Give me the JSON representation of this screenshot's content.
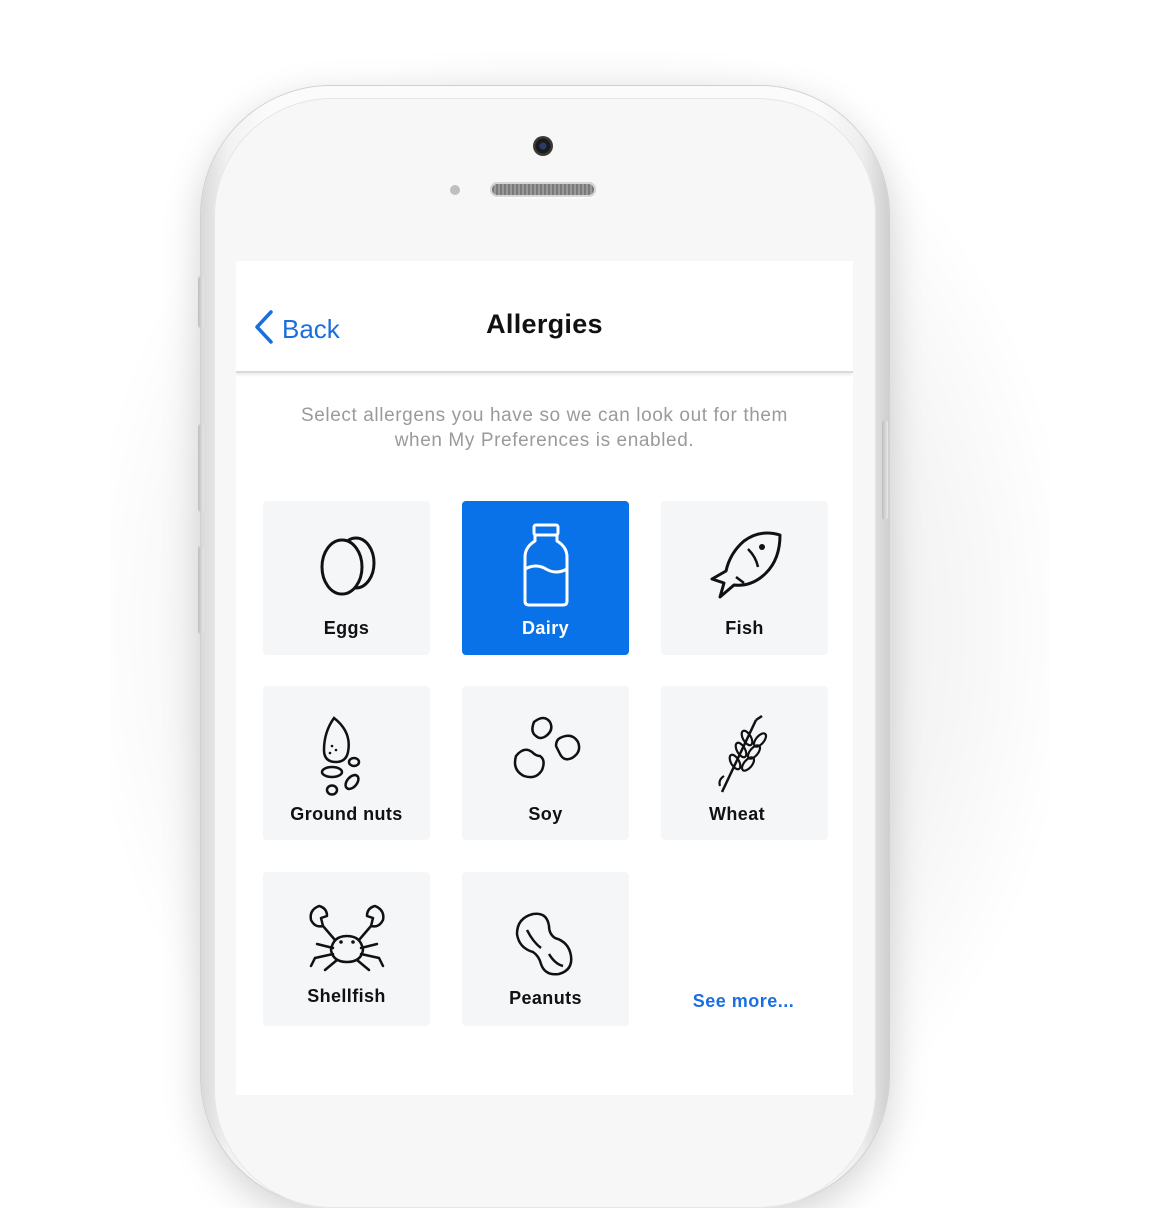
{
  "nav": {
    "back_label": "Back",
    "title": "Allergies"
  },
  "description": "Select allergens you have so we can look out for them when My Preferences is enabled.",
  "allergens": [
    {
      "label": "Eggs",
      "icon": "eggs-icon",
      "selected": false
    },
    {
      "label": "Dairy",
      "icon": "milk-bottle-icon",
      "selected": true
    },
    {
      "label": "Fish",
      "icon": "fish-icon",
      "selected": false
    },
    {
      "label": "Ground nuts",
      "icon": "ground-nuts-icon",
      "selected": false
    },
    {
      "label": "Soy",
      "icon": "soy-beans-icon",
      "selected": false
    },
    {
      "label": "Wheat",
      "icon": "wheat-icon",
      "selected": false
    },
    {
      "label": "Shellfish",
      "icon": "crab-icon",
      "selected": false
    },
    {
      "label": "Peanuts",
      "icon": "peanut-icon",
      "selected": false
    }
  ],
  "see_more_label": "See more...",
  "colors": {
    "accent": "#0a72e8",
    "link": "#1a6fe0",
    "tile_bg": "#f5f6f8"
  }
}
